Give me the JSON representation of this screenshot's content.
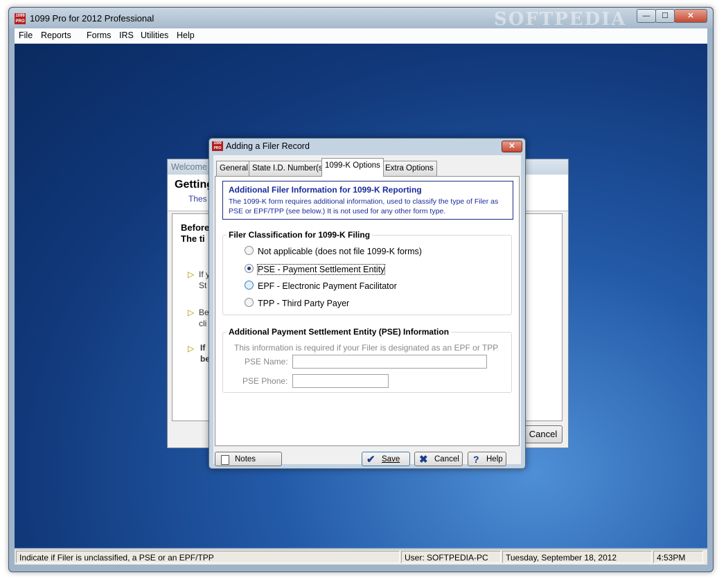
{
  "app": {
    "title": "1099 Pro for 2012 Professional",
    "logo_text": "1099 PRO",
    "watermark": "SOFTPEDIA",
    "minimize_glyph": "—",
    "maximize_glyph": "☐",
    "close_glyph": "✕"
  },
  "menu": {
    "items": [
      "File",
      "Reports",
      "Forms",
      "IRS",
      "Utilities",
      "Help"
    ]
  },
  "welcome": {
    "title": "Welcome",
    "heading": "Getting",
    "subtitle": "Thes",
    "body_line1": "Before",
    "body_line2": "The ti",
    "tips": [
      {
        "line1": "If y",
        "line2": "St"
      },
      {
        "line1": "Be",
        "line2": "cli"
      },
      {
        "line1": "If",
        "line2": "be"
      }
    ],
    "cancel_label": "Cancel"
  },
  "dialog": {
    "title": "Adding a Filer Record",
    "tabs": [
      "General",
      "State I.D. Number(s)",
      "1099-K Options",
      "Extra Options"
    ],
    "active_tab": "1099-K Options",
    "info": {
      "title": "Additional Filer Information for 1099-K Reporting",
      "description": "The 1099-K form requires additional information, used to classify the type of Filer as PSE or EPF/TPP (see below.)  It is not used for any other form type."
    },
    "classification": {
      "title": "Filer Classification for 1099-K Filing",
      "options": [
        "Not applicable (does not file 1099-K forms)",
        "PSE - Payment Settlement Entity",
        "EPF - Electronic Payment Facilitator",
        "TPP - Third Party Payer"
      ],
      "selected": "PSE - Payment Settlement Entity"
    },
    "pse": {
      "title": "Additional Payment Settlement Entity (PSE) Information",
      "note": "This information is required if your Filer is designated as an EPF or TPP",
      "name_label": "PSE Name:",
      "name_value": "",
      "phone_label": "PSE Phone:",
      "phone_value": ""
    },
    "buttons": {
      "notes": "Notes",
      "save": "Save",
      "cancel": "Cancel",
      "help": "Help"
    },
    "icons": {
      "notes": "notes-icon",
      "save": "checkmark-icon",
      "cancel": "x-icon",
      "help": "question-icon"
    }
  },
  "status_bar": {
    "message": "Indicate if Filer is unclassified, a PSE or an EPF/TPP",
    "user": "User: SOFTPEDIA-PC",
    "date": "Tuesday, September 18, 2012",
    "time": "4:53PM"
  },
  "colors": {
    "desktop": "#235aa8",
    "info_text": "#1a2a9a",
    "dialog_frame": "#c4d3e2"
  }
}
